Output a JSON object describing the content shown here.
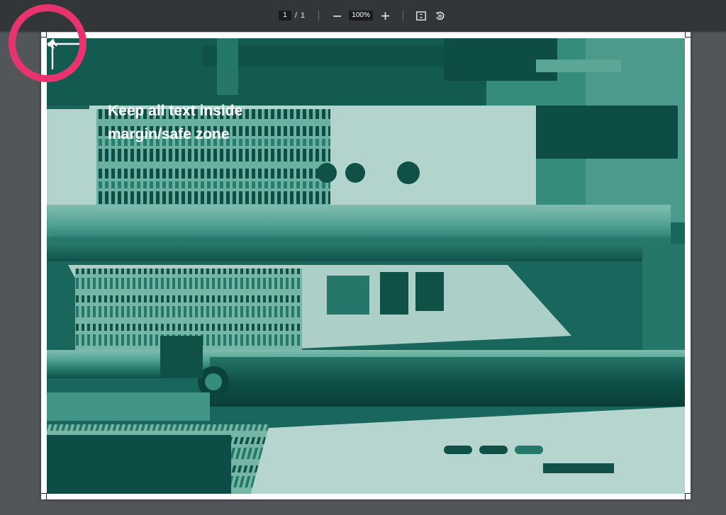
{
  "toolbar": {
    "current_page": "1",
    "page_separator": "/",
    "total_pages": "1",
    "zoom_out_icon": "minus-icon",
    "zoom_level": "100%",
    "zoom_in_icon": "plus-icon",
    "fit_icon": "fit-to-page-icon",
    "rotate_icon": "rotate-counterclockwise-icon"
  },
  "document": {
    "caption": "Keep all text inside\nmargin/safe zone",
    "arrow_up_icon": "arrow-up-icon",
    "arrow_left_icon": "arrow-left-icon",
    "image_subject": "printing-press-photo"
  },
  "annotation": {
    "highlight_color": "#e8336e",
    "icon": "highlight-circle"
  },
  "colors": {
    "toolbar_bg": "#323639",
    "viewer_bg": "#525659",
    "duotone_dark": "#0f4d45",
    "duotone_mid": "#1f7a6c",
    "duotone_light": "#5fb3a2"
  }
}
